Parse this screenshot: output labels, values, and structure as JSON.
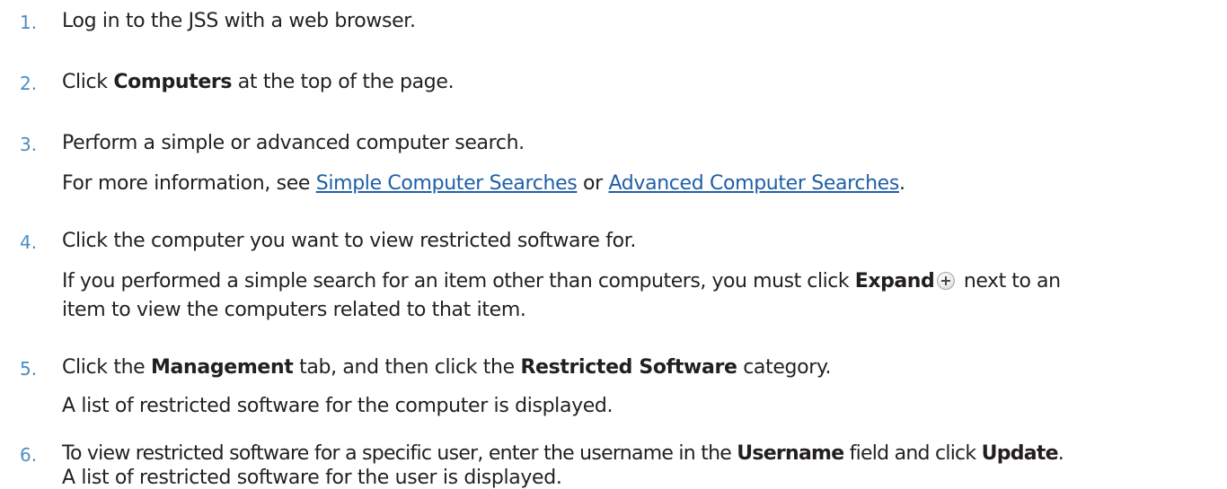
{
  "steps": [
    {
      "number": "1.",
      "text": "Log in to the JSS with a web browser."
    },
    {
      "number": "2.",
      "pre": "Click ",
      "bold": "Computers",
      "post": " at the top of the page."
    },
    {
      "number": "3.",
      "text": "Perform a simple or advanced computer search.",
      "sub_pre": "For more information, see ",
      "link1": "Simple Computer Searches",
      "sub_mid": " or ",
      "link2": "Advanced Computer Searches",
      "sub_post": "."
    },
    {
      "number": "4.",
      "text": "Click the computer you want to view restricted software for.",
      "sub_pre": "If you performed a simple search for an item other than computers, you must click ",
      "sub_bold": "Expand",
      "sub_post": " next to an",
      "sub_line2": "item to view the computers related to that item."
    },
    {
      "number": "5.",
      "pre": "Click the ",
      "bold1": "Management",
      "mid": " tab, and then click the ",
      "bold2": "Restricted Software",
      "post": " category.",
      "sub": "A list of restricted software for the computer is displayed."
    },
    {
      "number": "6.",
      "pre": "To view restricted software for a specific user, enter the username in the ",
      "bold1": "Username",
      "mid": " field and click ",
      "bold2": "Update",
      "post": ".",
      "sub": "A list of restricted software for the user is displayed."
    }
  ],
  "colors": {
    "number": "#4b8ec4",
    "link": "#1f5fa8",
    "text": "#231f20"
  },
  "icons": {
    "expand": "plus-icon"
  }
}
